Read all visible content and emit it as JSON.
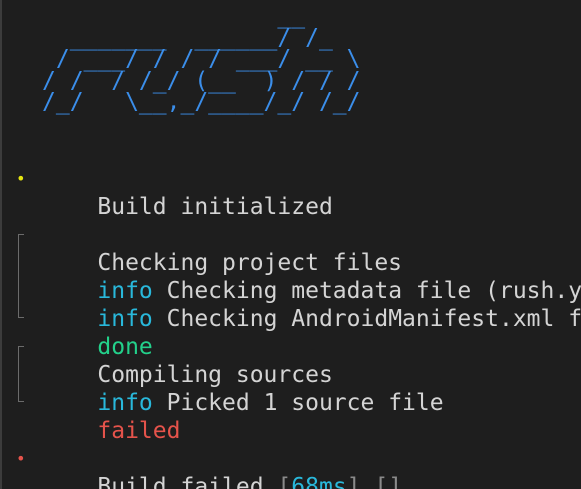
{
  "banner": "                 __\n  _______  ______/ /_\n / ___/ / / / ___/ __ \\\n/ /  / /_/ (__  ) / / /\n/_/   \\__,_/____/_/ /_/",
  "colors": {
    "background": "#1e1e1e",
    "text": "#d4d4d4",
    "banner": "#3b8eea",
    "info": "#29b8db",
    "done": "#23d18b",
    "failed": "#e5534b",
    "bullet_start": "#e5e510",
    "bullet_end": "#e5534b",
    "muted": "#8a8a8a"
  },
  "build_start": {
    "bullet": "•",
    "text": "Build initialized"
  },
  "groups": [
    {
      "title": "Checking project files",
      "logs": [
        {
          "level": "info",
          "text": "Checking metadata file (rush.yml)"
        },
        {
          "level": "info",
          "text": "Checking AndroidManifest.xml file"
        }
      ],
      "status": "done"
    },
    {
      "title": "Compiling sources",
      "logs": [
        {
          "level": "info",
          "text": "Picked 1 source file"
        }
      ],
      "status": "failed"
    }
  ],
  "build_end": {
    "bullet": "•",
    "text": "Build failed",
    "open_bracket": "[",
    "duration": "68ms",
    "close_bracket": "]",
    "empty_brackets": "[]"
  }
}
